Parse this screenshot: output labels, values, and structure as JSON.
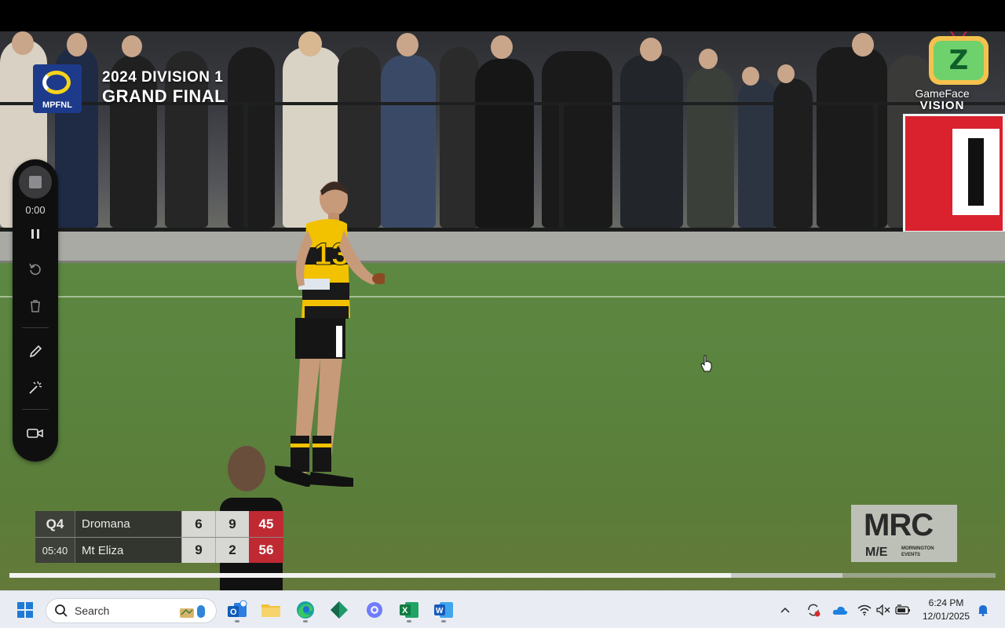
{
  "broadcast": {
    "competition_logo_text": "MPFNL",
    "title_line1": "2024 DIVISION 1",
    "title_line2": "GRAND FINAL",
    "channel_line1": "GameFace",
    "channel_line2": "VISION",
    "sponsor_big": "MRC",
    "sponsor_me": "M/E",
    "sponsor_small": "MORNINGTON EVENTS"
  },
  "scoreboard": {
    "quarter": "Q4",
    "clock": "05:40",
    "teams": [
      {
        "name": "Dromana",
        "goals": "6",
        "behinds": "9",
        "total": "45"
      },
      {
        "name": "Mt Eliza",
        "goals": "9",
        "behinds": "2",
        "total": "56"
      }
    ]
  },
  "player": {
    "number": "13"
  },
  "playback": {
    "progress": 0.732,
    "buffered": 0.845
  },
  "recorder": {
    "elapsed": "0:00",
    "buttons": [
      "stop-recording",
      "pause",
      "restart",
      "delete",
      "pen",
      "highlighter-effects",
      "camera"
    ]
  },
  "taskbar": {
    "search_label": "Search",
    "apps": [
      "start",
      "search",
      "outlook",
      "file-explorer",
      "edge",
      "app-diamond",
      "app-gear",
      "excel",
      "word"
    ],
    "time": "6:24 PM",
    "date": "12/01/2025"
  },
  "colors": {
    "score_total_bg": "#bf2a32",
    "recorder_bg": "#0f0f10",
    "taskbar_bg": "#e9edf3",
    "field_green": "#5a833e"
  }
}
